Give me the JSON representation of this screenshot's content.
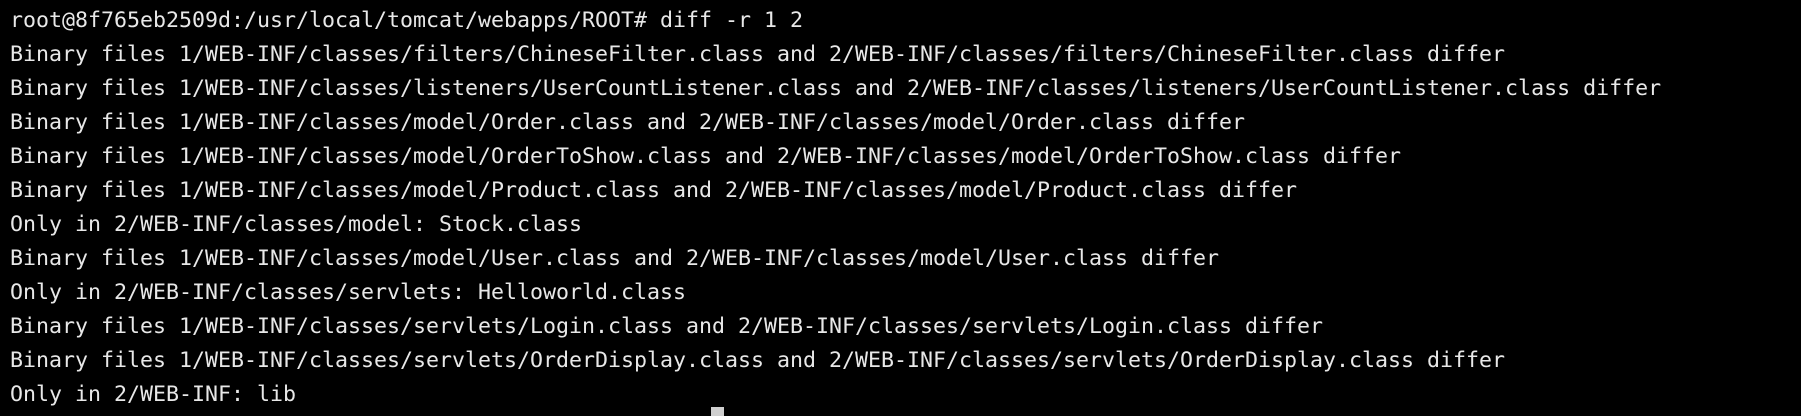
{
  "terminal": {
    "prompt": "root@8f765eb2509d:/usr/local/tomcat/webapps/ROOT# ",
    "command": "diff -r 1 2",
    "output_lines": [
      "Binary files 1/WEB-INF/classes/filters/ChineseFilter.class and 2/WEB-INF/classes/filters/ChineseFilter.class differ",
      "Binary files 1/WEB-INF/classes/listeners/UserCountListener.class and 2/WEB-INF/classes/listeners/UserCountListener.class differ",
      "Binary files 1/WEB-INF/classes/model/Order.class and 2/WEB-INF/classes/model/Order.class differ",
      "Binary files 1/WEB-INF/classes/model/OrderToShow.class and 2/WEB-INF/classes/model/OrderToShow.class differ",
      "Binary files 1/WEB-INF/classes/model/Product.class and 2/WEB-INF/classes/model/Product.class differ",
      "Only in 2/WEB-INF/classes/model: Stock.class",
      "Binary files 1/WEB-INF/classes/model/User.class and 2/WEB-INF/classes/model/User.class differ",
      "Only in 2/WEB-INF/classes/servlets: Helloworld.class",
      "Binary files 1/WEB-INF/classes/servlets/Login.class and 2/WEB-INF/classes/servlets/Login.class differ",
      "Binary files 1/WEB-INF/classes/servlets/OrderDisplay.class and 2/WEB-INF/classes/servlets/OrderDisplay.class differ",
      "Only in 2/WEB-INF: lib"
    ],
    "colors": {
      "background": "#000000",
      "foreground": "#e8e8e8",
      "cursor": "#cfcfcf"
    }
  }
}
